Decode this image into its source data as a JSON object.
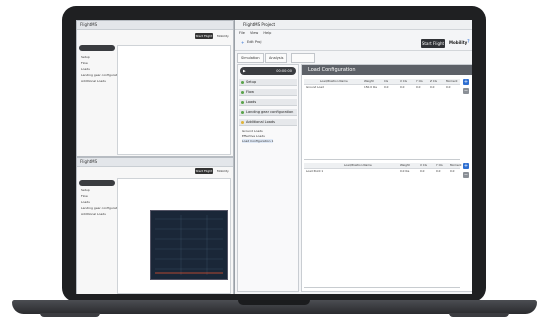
{
  "main_window": {
    "title": "FlightMS Project",
    "menu": [
      "File",
      "View",
      "Help"
    ],
    "toolbar": {
      "project_label": "Edit Proj",
      "sim_button": "Start Flight",
      "run_label": "Mobility"
    },
    "tabs": [
      "Simulation",
      "Analysis",
      ""
    ],
    "timer": "00:00:00",
    "nav": [
      {
        "label": "Setup"
      },
      {
        "label": "Flow"
      },
      {
        "label": "Loads"
      },
      {
        "label": "Landing gear configuration"
      },
      {
        "label": "Additional Loads"
      }
    ],
    "nav_sub": [
      "Ground Loads",
      "Effective Loads",
      "Load Configuration 1"
    ],
    "panel_title": "Load Configuration",
    "table1": {
      "columns": [
        "Load/Position Name",
        "Weight",
        "CG",
        "X CG",
        "Y CG",
        "Z CG",
        "Moment"
      ],
      "rows": [
        [
          "Ground Load",
          "150.0 lbs",
          "0.0",
          "0.0",
          "0.0",
          "0.0",
          "0.0"
        ]
      ]
    },
    "table2": {
      "columns": [
        "Load/Position Name",
        "Weight",
        "X CG",
        "Y CG",
        "Moment"
      ],
      "rows": [
        [
          "Load Point 1",
          "0.0 lbs",
          "0.0",
          "0.0",
          "0.0"
        ]
      ]
    }
  },
  "left_window_top": {
    "title": "FlightMS",
    "sim_button": "Start Flight",
    "run_label": "Mobility",
    "nav": [
      "Setup",
      "Flow",
      "Loads",
      "Landing gear configuration",
      "Additional Loads"
    ]
  },
  "left_window_bottom": {
    "title": "FlightMS",
    "sim_button": "Start Flight",
    "run_label": "Mobility",
    "nav": [
      "Setup",
      "Flow",
      "Loads",
      "Landing gear configuration",
      "Additional Loads"
    ]
  },
  "colors": {
    "accent": "#2f6fd1",
    "add": "#2f6fd1",
    "remove": "#8a8f96",
    "chart_bg": "#1a2738"
  }
}
